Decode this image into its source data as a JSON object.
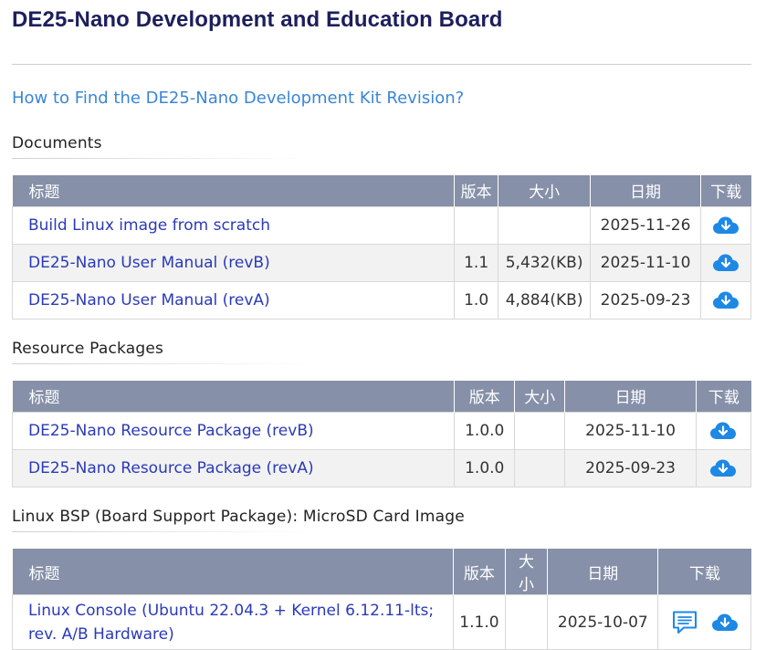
{
  "page": {
    "title": "DE25-Nano Development and Education Board",
    "revision_link": "How to Find the DE25-Nano Development Kit Revision?"
  },
  "colors": {
    "header_bg": "#8690a8",
    "link": "#2a3ab8",
    "download_icon": "#1e88e5",
    "title": "#1c1f5c"
  },
  "headers": {
    "title": "标题",
    "version": "版本",
    "size": "大小",
    "date": "日期",
    "download": "下载"
  },
  "documents": {
    "heading": "Documents",
    "rows": [
      {
        "title": "Build Linux image from scratch",
        "version": "",
        "size": "",
        "date": "2025-11-26",
        "icons": [
          "cloud-download-icon"
        ]
      },
      {
        "title": "DE25-Nano User Manual (revB)",
        "version": "1.1",
        "size": "5,432(KB)",
        "date": "2025-11-10",
        "icons": [
          "cloud-download-icon"
        ]
      },
      {
        "title": "DE25-Nano User Manual (revA)",
        "version": "1.0",
        "size": "4,884(KB)",
        "date": "2025-09-23",
        "icons": [
          "cloud-download-icon"
        ]
      }
    ]
  },
  "resources": {
    "heading": "Resource Packages",
    "rows": [
      {
        "title": "DE25-Nano Resource Package (revB)",
        "version": "1.0.0",
        "size": "",
        "date": "2025-11-10",
        "icons": [
          "cloud-download-icon"
        ]
      },
      {
        "title": "DE25-Nano Resource Package (revA)",
        "version": "1.0.0",
        "size": "",
        "date": "2025-09-23",
        "icons": [
          "cloud-download-icon"
        ]
      }
    ]
  },
  "linux_bsp": {
    "heading": "Linux BSP (Board Support Package): MicroSD Card Image",
    "rows": [
      {
        "title_line1": "Linux Console (Ubuntu 22.04.3 + Kernel 6.12.11-lts;",
        "title_line2": "rev. A/B Hardware)",
        "version": "1.1.0",
        "size": "",
        "date": "2025-10-07",
        "icons": [
          "message-icon",
          "cloud-download-icon"
        ]
      }
    ]
  }
}
